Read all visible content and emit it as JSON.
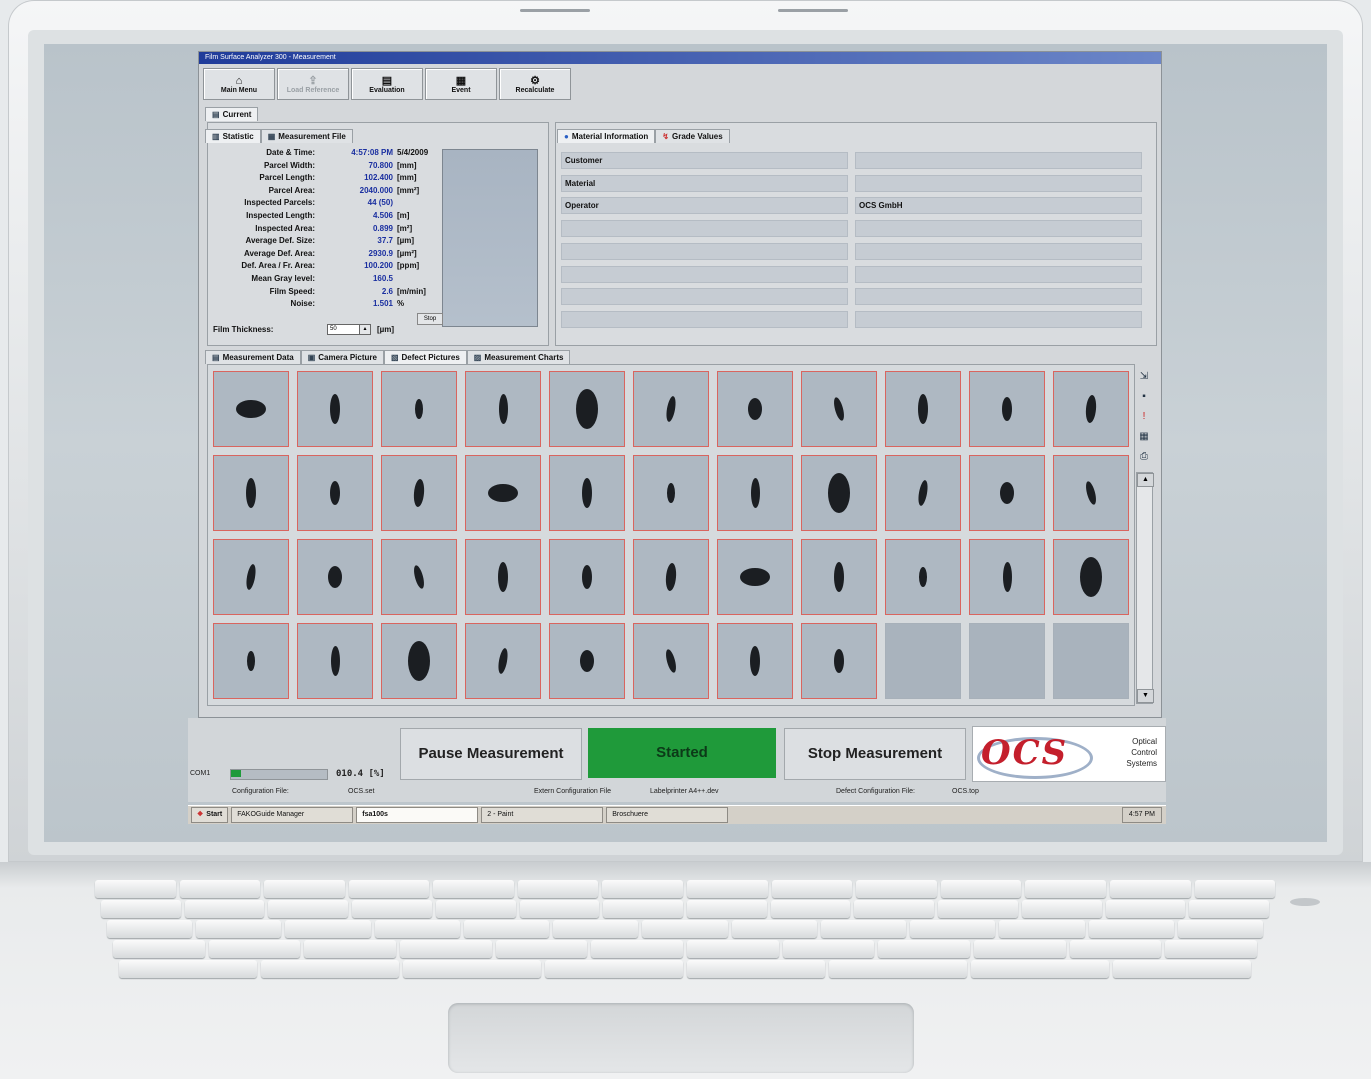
{
  "window": {
    "title": "Film Surface Analyzer 300 - Measurement"
  },
  "toolbar": [
    {
      "label": "Main Menu",
      "icon": "home-icon",
      "disabled": false
    },
    {
      "label": "Load Reference",
      "icon": "load-icon",
      "disabled": true
    },
    {
      "label": "Evaluation",
      "icon": "evaluation-icon",
      "disabled": false
    },
    {
      "label": "Event",
      "icon": "event-icon",
      "disabled": false
    },
    {
      "label": "Recalculate",
      "icon": "recalc-icon",
      "disabled": false
    }
  ],
  "current_tab": "Current",
  "stat_tabs": [
    "Statistic",
    "Measurement File"
  ],
  "statistics": [
    {
      "label": "Date & Time:",
      "value": "4:57:08 PM",
      "unit": "5/4/2009"
    },
    {
      "label": "Parcel Width:",
      "value": "70.800",
      "unit": "[mm]"
    },
    {
      "label": "Parcel Length:",
      "value": "102.400",
      "unit": "[mm]"
    },
    {
      "label": "Parcel Area:",
      "value": "2040.000",
      "unit": "[mm²]"
    },
    {
      "label": "Inspected Parcels:",
      "value": "44 (50)",
      "unit": ""
    },
    {
      "label": "Inspected Length:",
      "value": "4.506",
      "unit": "[m]"
    },
    {
      "label": "Inspected Area:",
      "value": "0.899",
      "unit": "[m²]"
    },
    {
      "label": "Average Def. Size:",
      "value": "37.7",
      "unit": "[µm]"
    },
    {
      "label": "Average Def. Area:",
      "value": "2930.9",
      "unit": "[µm²]"
    },
    {
      "label": "Def. Area / Fr. Area:",
      "value": "100.200",
      "unit": "[ppm]"
    },
    {
      "label": "Mean Gray level:",
      "value": "160.5",
      "unit": ""
    },
    {
      "label": "Film Speed:",
      "value": "2.6",
      "unit": "[m/min]"
    },
    {
      "label": "Noise:",
      "value": "1.501",
      "unit": "%"
    }
  ],
  "film_thickness": {
    "label": "Film Thickness:",
    "value": "50",
    "unit": "[µm]"
  },
  "stop_label": "Stop",
  "info_tabs": [
    "Material Information",
    "Grade Values"
  ],
  "info_rows": [
    {
      "label": "Customer",
      "value": ""
    },
    {
      "label": "Material",
      "value": ""
    },
    {
      "label": "Operator",
      "value": "OCS GmbH"
    },
    {
      "label": "",
      "value": ""
    },
    {
      "label": "",
      "value": ""
    },
    {
      "label": "",
      "value": ""
    },
    {
      "label": "",
      "value": ""
    },
    {
      "label": "",
      "value": ""
    }
  ],
  "defect_tabs": [
    "Measurement Data",
    "Camera Picture",
    "Defect Pictures",
    "Measurement Charts"
  ],
  "defect_grid": {
    "rows": 4,
    "cols": 11,
    "filled": 41
  },
  "side_tools": [
    "export-icon",
    "save-icon",
    "alert-icon",
    "chart-icon",
    "print-icon"
  ],
  "buttons": {
    "pause": "Pause Measurement",
    "started": "Started",
    "stop": "Stop Measurement"
  },
  "logo": {
    "main": "OCS",
    "tag": [
      "Optical",
      "Control",
      "Systems"
    ]
  },
  "status": {
    "com": "COM1",
    "progress_percent": 10,
    "progress_text": "010.4 [%]",
    "config_file_label": "Configuration File:",
    "config_file": "OCS.set",
    "extern_config_label": "Extern Configuration File",
    "labelprinter": "Labelprinter A4++.dev",
    "defect_config_label": "Defect Configuration File:",
    "defect_config": "OCS.top"
  },
  "taskbar": {
    "start": "Start",
    "items": [
      "FAKOGuide Manager",
      "fsa100s",
      "2 - Paint",
      "Broschuere"
    ],
    "active": "fsa100s",
    "clock": "4:57 PM"
  },
  "colors": {
    "accent_green": "#1f9a3a",
    "defect_border": "#d9655f",
    "titlebar": "#203c9a",
    "logo_red": "#c41f2c"
  }
}
